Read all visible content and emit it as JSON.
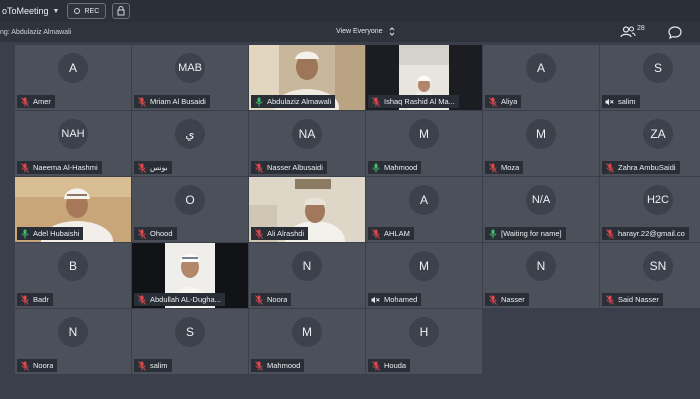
{
  "topbar": {
    "app_title": "oToMeeting",
    "rec_label": "REC"
  },
  "subbar": {
    "speaking": "ng: Abdulaziz Almawali",
    "view_label": "View Everyone",
    "attendee_count": "28"
  },
  "participants": [
    {
      "name": "Amer",
      "initials": "A",
      "mic": "muted",
      "video": false
    },
    {
      "name": "Mriam Al Busaidi",
      "initials": "MAB",
      "mic": "muted",
      "video": false
    },
    {
      "name": "Abdulaziz Almawali",
      "initials": "",
      "mic": "on",
      "video": true
    },
    {
      "name": "Ishaq Rashid Al Ma...",
      "initials": "",
      "mic": "muted",
      "video": true
    },
    {
      "name": "Aliya",
      "initials": "A",
      "mic": "muted",
      "video": false
    },
    {
      "name": "salim",
      "initials": "S",
      "mic": "speaker-off",
      "video": false
    },
    {
      "name": "Naeema Al-Hashmi",
      "initials": "NAH",
      "mic": "muted",
      "video": false
    },
    {
      "name": "بونس",
      "initials": "ي",
      "mic": "muted",
      "video": false
    },
    {
      "name": "Nasser Albusaidi",
      "initials": "NA",
      "mic": "muted",
      "video": false
    },
    {
      "name": "Mahmood",
      "initials": "M",
      "mic": "on",
      "video": false
    },
    {
      "name": "Moza",
      "initials": "M",
      "mic": "muted",
      "video": false
    },
    {
      "name": "Zahra AmbuSaidi",
      "initials": "ZA",
      "mic": "muted",
      "video": false
    },
    {
      "name": "Adel Hubaishi",
      "initials": "",
      "mic": "on",
      "video": true
    },
    {
      "name": "Ohood",
      "initials": "O",
      "mic": "muted",
      "video": false
    },
    {
      "name": "Ali Alrashdi",
      "initials": "",
      "mic": "muted",
      "video": true
    },
    {
      "name": "AHLAM",
      "initials": "A",
      "mic": "muted",
      "video": false
    },
    {
      "name": "[Waiting for name]",
      "initials": "N/A",
      "mic": "on",
      "video": false
    },
    {
      "name": "harayr.22@gmail.co",
      "initials": "H2C",
      "mic": "muted",
      "video": false
    },
    {
      "name": "Badr",
      "initials": "B",
      "mic": "muted",
      "video": false
    },
    {
      "name": "Abdullah AL-Dugha...",
      "initials": "",
      "mic": "muted",
      "video": true
    },
    {
      "name": "Noora",
      "initials": "N",
      "mic": "muted",
      "video": false
    },
    {
      "name": "Mohamed",
      "initials": "M",
      "mic": "speaker-off",
      "video": false
    },
    {
      "name": "Nasser",
      "initials": "N",
      "mic": "muted",
      "video": false
    },
    {
      "name": "Said Nasser",
      "initials": "SN",
      "mic": "muted",
      "video": false
    },
    {
      "name": "Noora",
      "initials": "N",
      "mic": "muted",
      "video": false
    },
    {
      "name": "salim",
      "initials": "S",
      "mic": "muted",
      "video": false
    },
    {
      "name": "Mahmood",
      "initials": "M",
      "mic": "muted",
      "video": false
    },
    {
      "name": "Houda",
      "initials": "H",
      "mic": "muted",
      "video": false
    }
  ],
  "colors": {
    "muted_mic": "#e0484f",
    "active_mic": "#3fbf6a"
  }
}
